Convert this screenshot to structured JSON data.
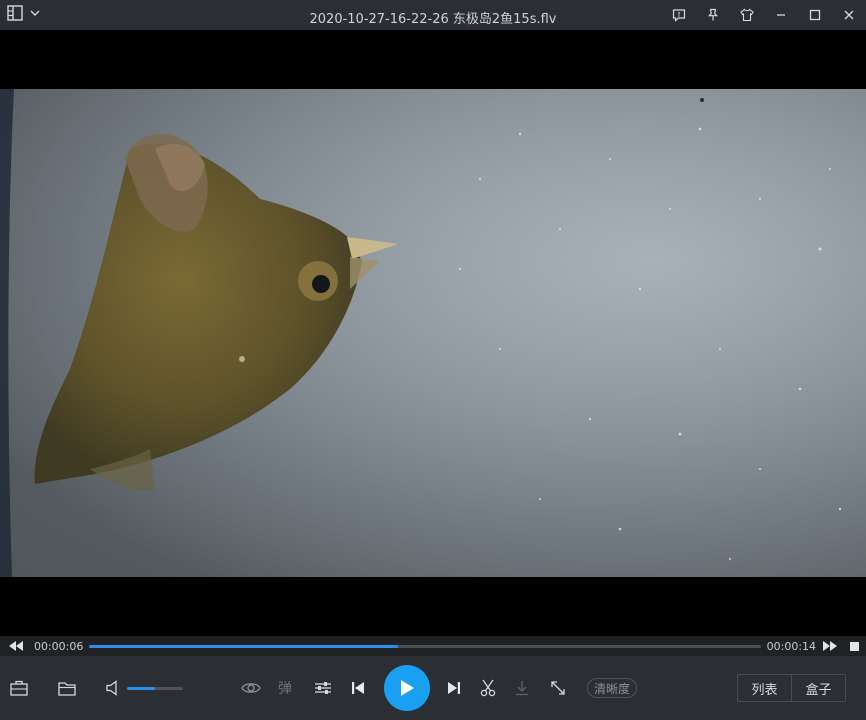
{
  "window": {
    "title": "2020-10-27-16-22-26 东极岛2鱼15s.flv"
  },
  "playback": {
    "current_time": "00:00:06",
    "total_time": "00:00:14",
    "progress": 0.46,
    "volume": 0.5
  },
  "controls": {
    "danmu_label": "弹",
    "quality_label": "清晰度",
    "playlist_label": "列表",
    "box_label": "盒子"
  },
  "colors": {
    "accent": "#1aa0f0",
    "progress": "#2e8fe8"
  }
}
